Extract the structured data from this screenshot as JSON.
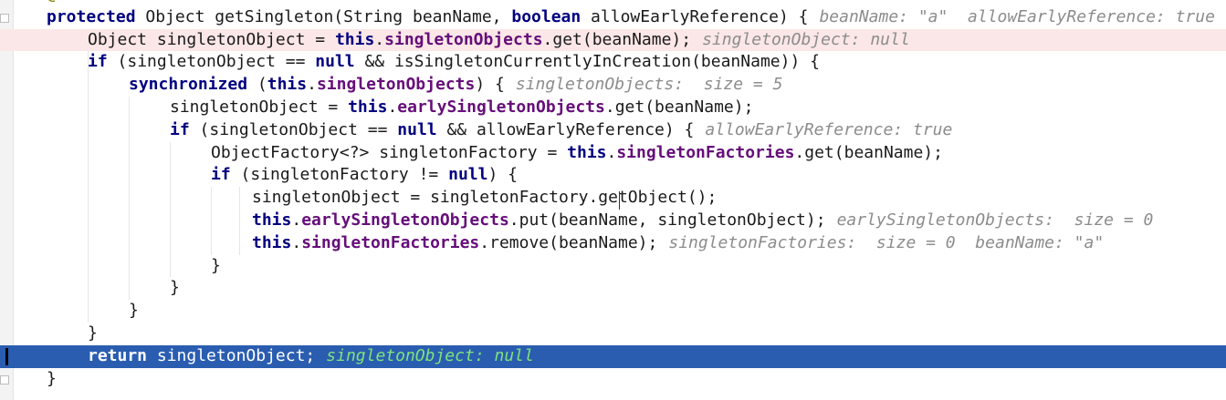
{
  "editor": {
    "lines": [
      {
        "indent": 0,
        "code": [
          {
            "t": "@Nullable",
            "c": "anno"
          }
        ],
        "value": ""
      },
      {
        "indent": 0,
        "code": [
          {
            "t": "protected",
            "c": "kw"
          },
          {
            "t": " Object getSingleton(String beanName, ",
            "c": ""
          },
          {
            "t": "boolean",
            "c": "kw"
          },
          {
            "t": " allowEarlyReference) {",
            "c": ""
          }
        ],
        "value": "beanName: \"a\"  allowEarlyReference: true"
      },
      {
        "indent": 1,
        "code": [
          {
            "t": "Object singletonObject = ",
            "c": ""
          },
          {
            "t": "this",
            "c": "kw"
          },
          {
            "t": ".",
            "c": ""
          },
          {
            "t": "singletonObjects",
            "c": "field"
          },
          {
            "t": ".get(beanName);",
            "c": ""
          }
        ],
        "value": "singletonObject: null"
      },
      {
        "indent": 1,
        "code": [
          {
            "t": "if",
            "c": "kw"
          },
          {
            "t": " (singletonObject == ",
            "c": ""
          },
          {
            "t": "null",
            "c": "kw"
          },
          {
            "t": " && isSingletonCurrentlyInCreation(beanName)) {",
            "c": ""
          }
        ],
        "value": ""
      },
      {
        "indent": 2,
        "code": [
          {
            "t": "synchronized",
            "c": "kw"
          },
          {
            "t": " (",
            "c": ""
          },
          {
            "t": "this",
            "c": "kw"
          },
          {
            "t": ".",
            "c": ""
          },
          {
            "t": "singletonObjects",
            "c": "field"
          },
          {
            "t": ") {",
            "c": ""
          }
        ],
        "value": "singletonObjects:  size = 5"
      },
      {
        "indent": 3,
        "code": [
          {
            "t": "singletonObject = ",
            "c": ""
          },
          {
            "t": "this",
            "c": "kw"
          },
          {
            "t": ".",
            "c": ""
          },
          {
            "t": "earlySingletonObjects",
            "c": "field"
          },
          {
            "t": ".get(beanName);",
            "c": ""
          }
        ],
        "value": ""
      },
      {
        "indent": 3,
        "code": [
          {
            "t": "if",
            "c": "kw"
          },
          {
            "t": " (singletonObject == ",
            "c": ""
          },
          {
            "t": "null",
            "c": "kw"
          },
          {
            "t": " && allowEarlyReference) {",
            "c": ""
          }
        ],
        "value": "allowEarlyReference: true"
      },
      {
        "indent": 4,
        "code": [
          {
            "t": "ObjectFactory<?> singletonFactory = ",
            "c": ""
          },
          {
            "t": "this",
            "c": "kw"
          },
          {
            "t": ".",
            "c": ""
          },
          {
            "t": "singletonFactories",
            "c": "field"
          },
          {
            "t": ".get(beanName);",
            "c": ""
          }
        ],
        "value": ""
      },
      {
        "indent": 4,
        "code": [
          {
            "t": "if",
            "c": "kw"
          },
          {
            "t": " (singletonFactory != ",
            "c": ""
          },
          {
            "t": "null",
            "c": "kw"
          },
          {
            "t": ") {",
            "c": ""
          }
        ],
        "value": ""
      },
      {
        "indent": 5,
        "code": [
          {
            "t": "singletonObject = singletonFactory.getObject();",
            "c": ""
          }
        ],
        "value": ""
      },
      {
        "indent": 5,
        "code": [
          {
            "t": "this",
            "c": "kw"
          },
          {
            "t": ".",
            "c": ""
          },
          {
            "t": "earlySingletonObjects",
            "c": "field"
          },
          {
            "t": ".put(beanName, singletonObject);",
            "c": ""
          }
        ],
        "value": "earlySingletonObjects:  size = 0"
      },
      {
        "indent": 5,
        "code": [
          {
            "t": "this",
            "c": "kw"
          },
          {
            "t": ".",
            "c": ""
          },
          {
            "t": "singletonFactories",
            "c": "field"
          },
          {
            "t": ".remove(beanName);",
            "c": ""
          }
        ],
        "value": "singletonFactories:  size = 0  beanName: \"a\""
      },
      {
        "indent": 4,
        "code": [
          {
            "t": "}",
            "c": ""
          }
        ],
        "value": ""
      },
      {
        "indent": 3,
        "code": [
          {
            "t": "}",
            "c": ""
          }
        ],
        "value": ""
      },
      {
        "indent": 2,
        "code": [
          {
            "t": "}",
            "c": ""
          }
        ],
        "value": ""
      },
      {
        "indent": 1,
        "code": [
          {
            "t": "}",
            "c": ""
          }
        ],
        "value": ""
      },
      {
        "indent": 1,
        "code": [
          {
            "t": "return",
            "c": "kw"
          },
          {
            "t": " singletonObject;",
            "c": ""
          }
        ],
        "value": "singletonObject: null"
      },
      {
        "indent": 0,
        "code": [
          {
            "t": "}",
            "c": ""
          }
        ],
        "value": ""
      }
    ],
    "breakpoint_line": 2,
    "current_line": 16
  }
}
